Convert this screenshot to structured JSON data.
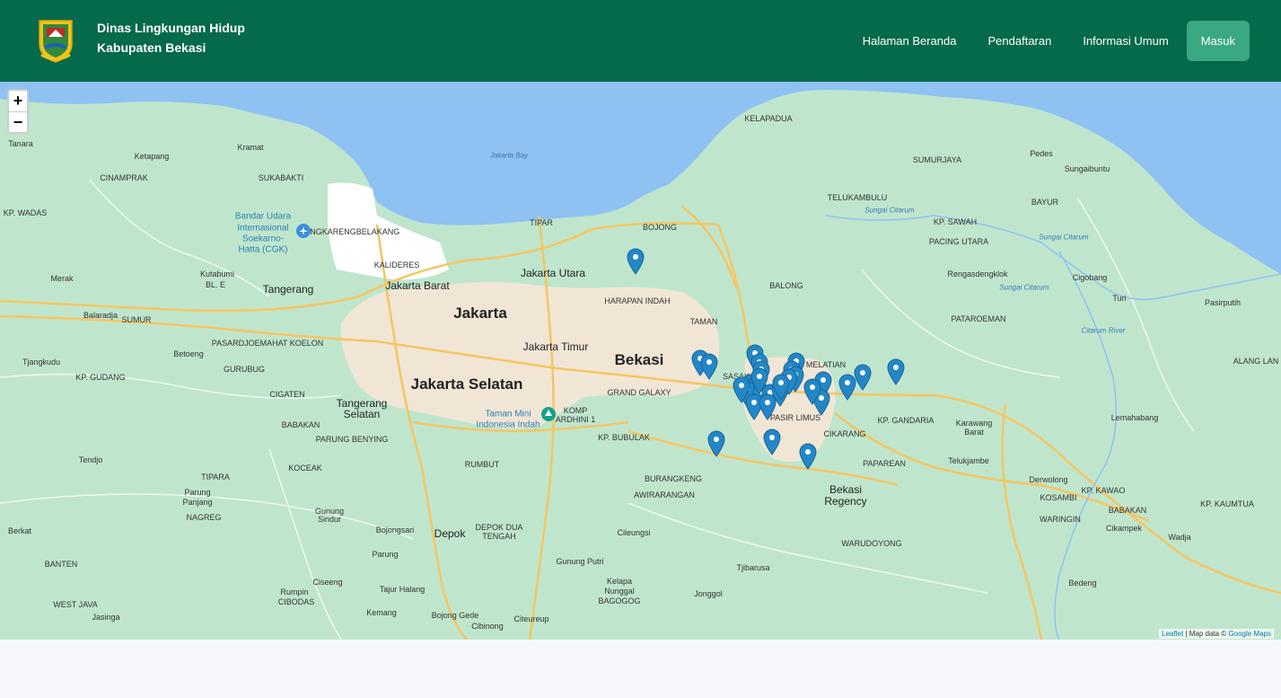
{
  "navbar": {
    "brand_line1": "Dinas Lingkungan Hidup",
    "brand_line2": "Kabupaten Bekasi",
    "links": [
      "Halaman Beranda",
      "Pendaftaran",
      "Informasi Umum"
    ],
    "login_label": "Masuk",
    "bg_color": "#05694b",
    "button_color": "#3aa880"
  },
  "map": {
    "zoom_in": "+",
    "zoom_out": "−",
    "attribution_leaflet": "Leaflet",
    "attribution_text": " | Map data © ",
    "attribution_google": "Google Maps",
    "labels": [
      [
        "Jakarta",
        "city"
      ],
      [
        "Bekasi",
        "city"
      ],
      [
        "Jakarta Selatan",
        "city"
      ],
      [
        "Jakarta Barat",
        "town"
      ],
      [
        "Jakarta Utara",
        "town"
      ],
      [
        "Jakarta Timur",
        "town"
      ],
      [
        "Tangerang",
        "town"
      ],
      [
        "Tangerang",
        "town"
      ],
      [
        "Selatan",
        "town"
      ],
      [
        "Depok",
        "town"
      ],
      [
        "Bekasi",
        "town"
      ],
      [
        "Regency",
        "town"
      ],
      [
        "Tanara",
        "small"
      ],
      [
        "Kramat",
        "small"
      ],
      [
        "Ketapang",
        "small"
      ],
      [
        "CINAMPRAK",
        "small"
      ],
      [
        "SUKABAKTI",
        "small"
      ],
      [
        "KP. WADAS",
        "small"
      ],
      [
        "Kutabumi",
        "small"
      ],
      [
        "BL. E",
        "small"
      ],
      [
        "Merak",
        "small"
      ],
      [
        "Balaradja",
        "small"
      ],
      [
        "SUMUR",
        "small"
      ],
      [
        "PASARDJOEMAHAT KOELON",
        "small"
      ],
      [
        "Tjangkudu",
        "small"
      ],
      [
        "KP. GUDANG",
        "small"
      ],
      [
        "Betoeng",
        "small"
      ],
      [
        "GURUBUG",
        "small"
      ],
      [
        "CIGATEN",
        "small"
      ],
      [
        "BABAKAN",
        "small"
      ],
      [
        "PARUNG BENYING",
        "small"
      ],
      [
        "Tendjo",
        "small"
      ],
      [
        "KOCEAK",
        "small"
      ],
      [
        "TIPARA",
        "small"
      ],
      [
        "Parung",
        "small"
      ],
      [
        "Panjang",
        "small"
      ],
      [
        "NAGREG",
        "small"
      ],
      [
        "Gunung",
        "small"
      ],
      [
        "Sindur",
        "small"
      ],
      [
        "Berkat",
        "small"
      ],
      [
        "Bojongsari",
        "small"
      ],
      [
        "Parung",
        "small"
      ],
      [
        "Ciseeng",
        "small"
      ],
      [
        "Rumpin",
        "small"
      ],
      [
        "CIBODAS",
        "small"
      ],
      [
        "Tajur Halang",
        "small"
      ],
      [
        "Kemang",
        "small"
      ],
      [
        "Jasinga",
        "small"
      ],
      [
        "Bojong Gede",
        "small"
      ],
      [
        "Cibinong",
        "small"
      ],
      [
        "Citeureup",
        "small"
      ],
      [
        "Gunung Putri",
        "small"
      ],
      [
        "Cileungsi",
        "small"
      ],
      [
        "Kelapa",
        "small"
      ],
      [
        "Nunggal",
        "small"
      ],
      [
        "BAGOGOG",
        "small"
      ],
      [
        "Jonggol",
        "small"
      ],
      [
        "Tjibarusa",
        "small"
      ],
      [
        "WARUDOYONG",
        "small"
      ],
      [
        "Cikampek",
        "small"
      ],
      [
        "Wadja",
        "small"
      ],
      [
        "Bedeng",
        "small"
      ],
      [
        "BABAKAN",
        "small"
      ],
      [
        "WARINGIN",
        "small"
      ],
      [
        "KOSAMBI",
        "small"
      ],
      [
        "KP. KAWAO",
        "small"
      ],
      [
        "KP. KAUMTUA",
        "small"
      ],
      [
        "Derwolong",
        "small"
      ],
      [
        "Telukjambe",
        "small"
      ],
      [
        "PAPAREAN",
        "small"
      ],
      [
        "Karawang",
        "small"
      ],
      [
        "Barat",
        "small"
      ],
      [
        "Lemahabang",
        "small"
      ],
      [
        "KP. GANDARIA",
        "small"
      ],
      [
        "CIKARANG",
        "small"
      ],
      [
        "PASIR LIMUS",
        "small"
      ],
      [
        "MELATIAN",
        "small"
      ],
      [
        "SASAK",
        "small"
      ],
      [
        "GRAND GALAXY",
        "small"
      ],
      [
        "KOMP",
        "small"
      ],
      [
        "ARDHINI 1",
        "small"
      ],
      [
        "KP. BUBULAK",
        "small"
      ],
      [
        "RUMBUT",
        "small"
      ],
      [
        "BURANGKENG",
        "small"
      ],
      [
        "AWIRARANGAN",
        "small"
      ],
      [
        "DEPOK DUA",
        "small"
      ],
      [
        "TENGAH",
        "small"
      ],
      [
        "TAMAN",
        "small"
      ],
      [
        "HARAPAN INDAH",
        "small"
      ],
      [
        "BALONG",
        "small"
      ],
      [
        "BOJONG",
        "small"
      ],
      [
        "KELAPADUA",
        "small"
      ],
      [
        "TELUKAMBULU",
        "small"
      ],
      [
        "SUMURJAYA",
        "small"
      ],
      [
        "Pedes",
        "small"
      ],
      [
        "Sungaibuntu",
        "small"
      ],
      [
        "BAYUR",
        "small"
      ],
      [
        "KP. SAWAH",
        "small"
      ],
      [
        "PACING UTARA",
        "small"
      ],
      [
        "Rengasdengklok",
        "small"
      ],
      [
        "Cigobang",
        "small"
      ],
      [
        "Turi",
        "small"
      ],
      [
        "Pasirputih",
        "small"
      ],
      [
        "PATAROEMAN",
        "small"
      ],
      [
        "ALANG LAN",
        "small"
      ],
      [
        "CENGKARENGBELAKANG",
        "small"
      ],
      [
        "TIPAR",
        "small"
      ],
      [
        "KALIDERES",
        "small"
      ],
      [
        "BANTEN",
        "small"
      ],
      [
        "WEST JAVA",
        "small"
      ],
      [
        "Jakarta Bay",
        "water"
      ],
      [
        "Sungai Citarum",
        "water"
      ],
      [
        "Sungai Citarum",
        "water"
      ],
      [
        "Sungai Citarum",
        "water"
      ],
      [
        "Citarum River",
        "water"
      ],
      [
        "Bandar Udara",
        "poi"
      ],
      [
        "Internasional",
        "poi"
      ],
      [
        "Soekarno-",
        "poi"
      ],
      [
        "Hatta (CGK)",
        "poi"
      ],
      [
        "Taman Mini",
        "poi"
      ],
      [
        "Indonesia Indah",
        "poi"
      ]
    ],
    "marker_count": 30,
    "marker_color": "#2387c6"
  }
}
